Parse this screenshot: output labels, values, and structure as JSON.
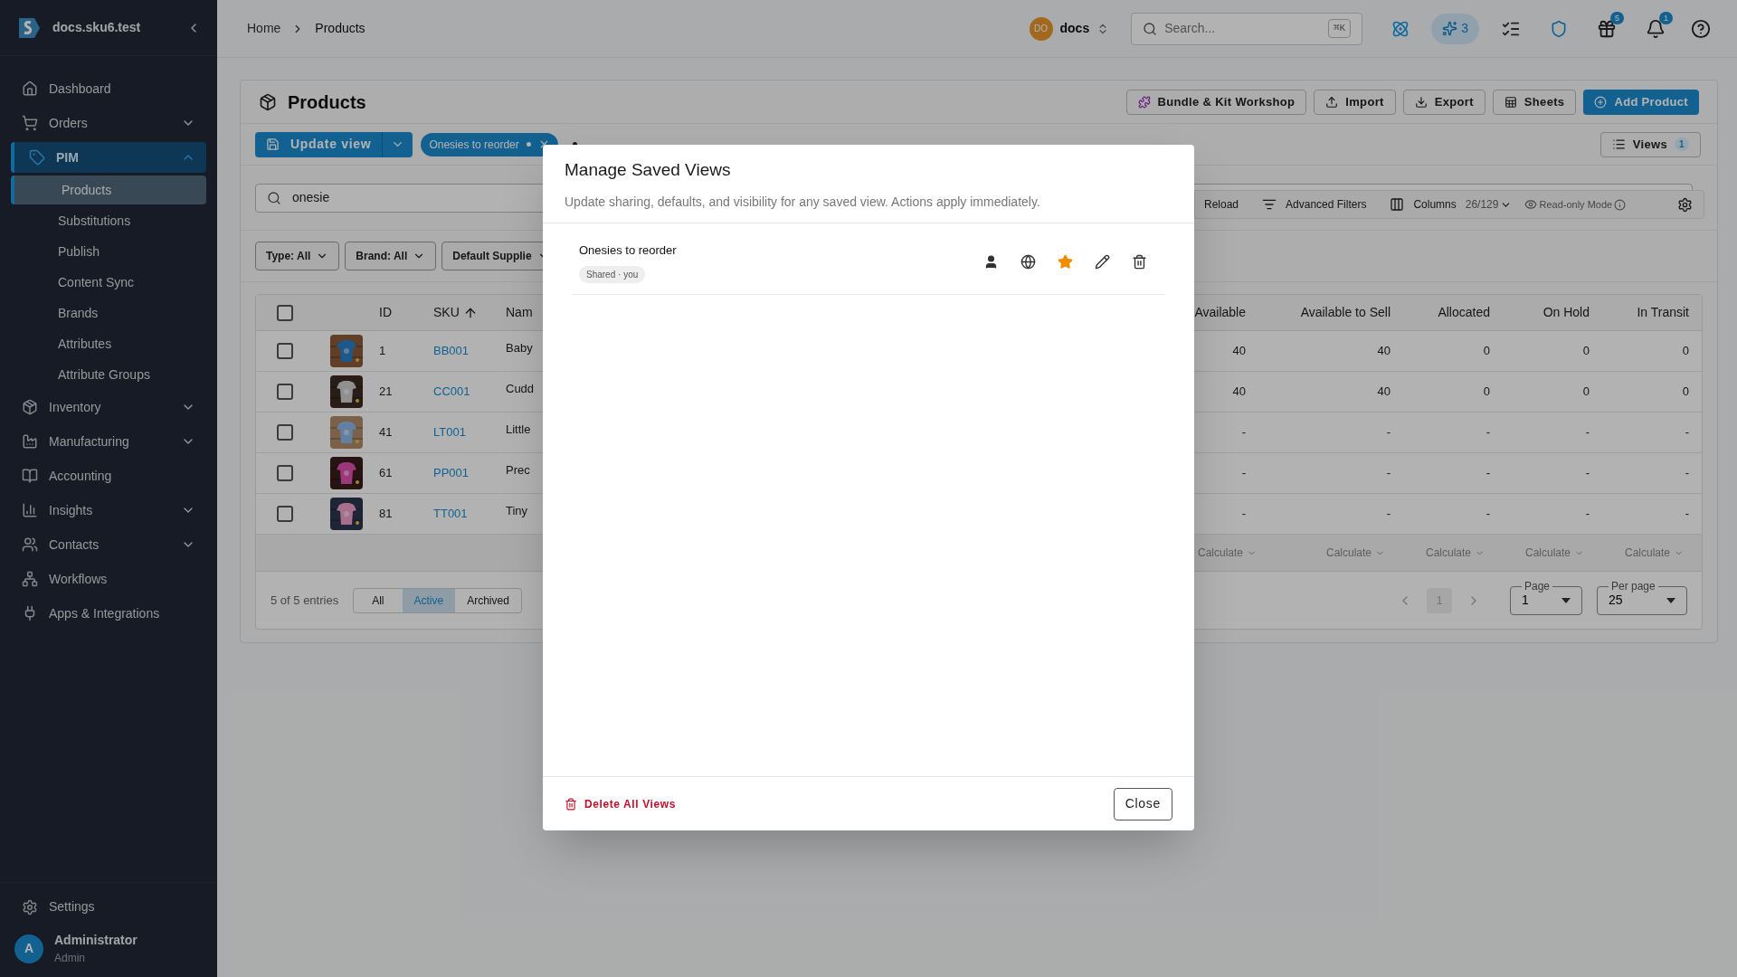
{
  "sidebar": {
    "brand": "docs.sku6.test",
    "items": [
      {
        "label": "Dashboard",
        "kind": "link",
        "selected": false
      },
      {
        "label": "Orders",
        "kind": "group",
        "expanded": false,
        "selected": false
      },
      {
        "label": "PIM",
        "kind": "group",
        "expanded": true,
        "selected": true,
        "children": [
          {
            "label": "Products",
            "selected": true
          },
          {
            "label": "Substitutions",
            "selected": false
          },
          {
            "label": "Publish",
            "selected": false
          },
          {
            "label": "Content Sync",
            "selected": false
          },
          {
            "label": "Brands",
            "selected": false
          },
          {
            "label": "Attributes",
            "selected": false
          },
          {
            "label": "Attribute Groups",
            "selected": false
          }
        ]
      },
      {
        "label": "Inventory",
        "kind": "group",
        "expanded": false,
        "selected": false
      },
      {
        "label": "Manufacturing",
        "kind": "group",
        "expanded": false,
        "selected": false
      },
      {
        "label": "Accounting",
        "kind": "link",
        "selected": false
      },
      {
        "label": "Insights",
        "kind": "group",
        "expanded": false,
        "selected": false
      },
      {
        "label": "Contacts",
        "kind": "group",
        "expanded": false,
        "selected": false
      },
      {
        "label": "Workflows",
        "kind": "link",
        "selected": false
      },
      {
        "label": "Apps & Integrations",
        "kind": "link",
        "selected": false
      }
    ],
    "settings": "Settings",
    "user": {
      "initial": "A",
      "name": "Administrator",
      "role": "Admin"
    }
  },
  "header": {
    "breadcrumbs": [
      "Home",
      "Products"
    ],
    "workspace": {
      "initials": "DO",
      "name": "docs"
    },
    "search": {
      "placeholder": "Search...",
      "shortcut": "⌘K"
    },
    "ai_count": "3",
    "gift_count": "5",
    "notification_count": "1"
  },
  "page": {
    "title": "Products",
    "actions": [
      "Bundle & Kit Workshop",
      "Import",
      "Export",
      "Sheets"
    ],
    "primary_action": "Add Product",
    "update_view": "Update view",
    "active_view": {
      "label": "Onesies to reorder",
      "unsaved": true
    },
    "views_button": {
      "label": "Views",
      "count": "1"
    },
    "search": {
      "value": "onesie"
    },
    "toolbar": {
      "reload": "Reload",
      "advanced_filters": "Advanced Filters",
      "columns": "Columns",
      "columns_count": "26/129",
      "read_only": "Read-only Mode"
    },
    "filters": [
      "Type: All",
      "Brand: All",
      "Default Supplie"
    ]
  },
  "table": {
    "all_checked": false,
    "columns": [
      {
        "label": "ID",
        "sorted": false
      },
      {
        "label": "SKU",
        "sorted": true
      },
      {
        "label": "Nam",
        "sorted": false
      },
      {
        "label": "Available",
        "sorted": false
      },
      {
        "label": "Available to Sell",
        "sorted": false
      },
      {
        "label": "Allocated",
        "sorted": false
      },
      {
        "label": "On Hold",
        "sorted": false
      },
      {
        "label": "In Transit",
        "sorted": false
      }
    ],
    "rows": [
      {
        "checked": false,
        "cells": [
          "1",
          "BB001",
          "Baby",
          "40",
          "40",
          "0",
          "0",
          "0"
        ]
      },
      {
        "checked": false,
        "cells": [
          "21",
          "CC001",
          "Cudd",
          "40",
          "40",
          "0",
          "0",
          "0"
        ]
      },
      {
        "checked": false,
        "cells": [
          "41",
          "LT001",
          "Little",
          "-",
          "-",
          "-",
          "-",
          "-"
        ]
      },
      {
        "checked": false,
        "cells": [
          "61",
          "PP001",
          "Prec",
          "-",
          "-",
          "-",
          "-",
          "-"
        ]
      },
      {
        "checked": false,
        "cells": [
          "81",
          "TT001",
          "Tiny",
          "-",
          "-",
          "-",
          "-",
          "-"
        ]
      }
    ],
    "footer": [
      "Calculate",
      "Calculate",
      "Calculate",
      "Calculate",
      "Calculate"
    ]
  },
  "pagination": {
    "entries": "5 of 5 entries",
    "status_tabs": [
      {
        "label": "All",
        "selected": false
      },
      {
        "label": "Active",
        "selected": true
      },
      {
        "label": "Archived",
        "selected": false
      }
    ],
    "current_page": "1",
    "page_label": "Page",
    "page": "1",
    "per_page_label": "Per page",
    "per_page": "25"
  },
  "modal": {
    "title": "Manage Saved Views",
    "subtitle": "Update sharing, defaults, and visibility for any saved view. Actions apply immediately.",
    "views": [
      {
        "name": "Onesies to reorder",
        "badge": "Shared · you",
        "default": true
      }
    ],
    "delete_all": "Delete All Views",
    "close": "Close"
  }
}
